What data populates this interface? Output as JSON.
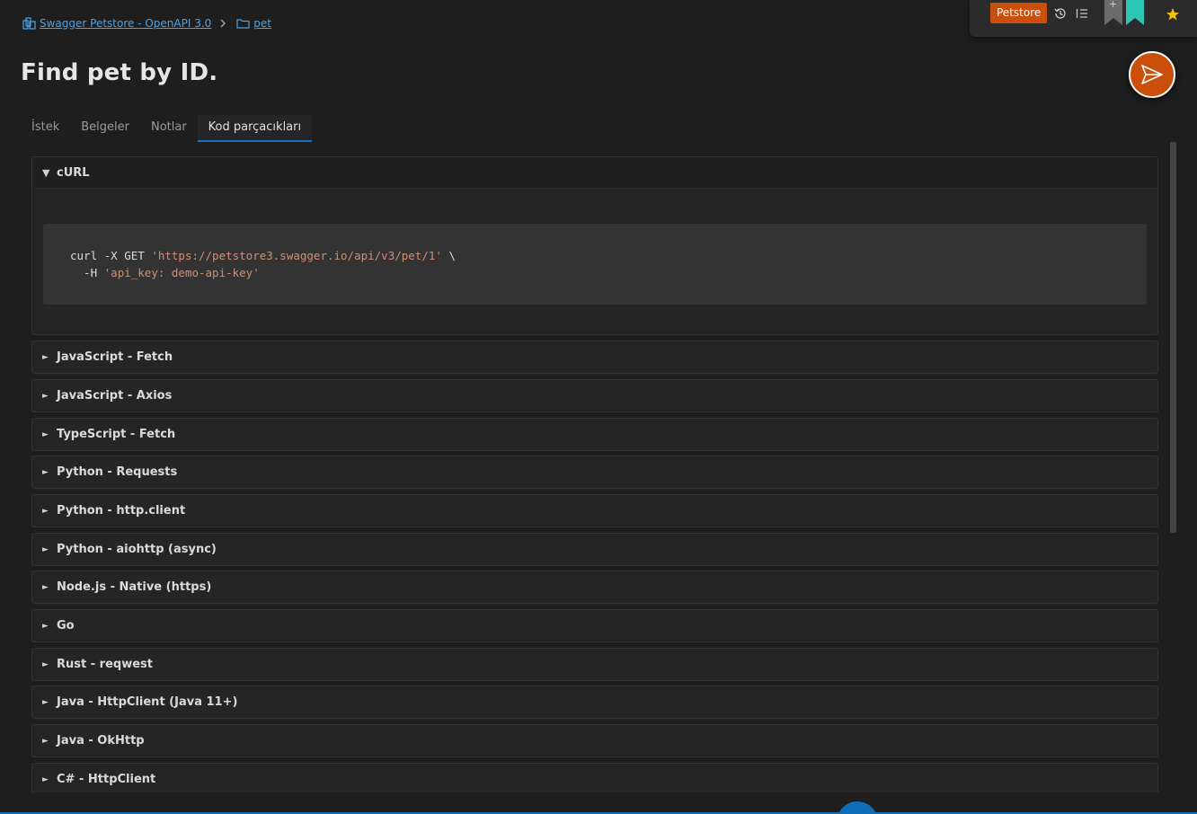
{
  "breadcrumb": {
    "collection": "Swagger Petstore - OpenAPI 3.0",
    "folder": "pet",
    "separator": ">"
  },
  "toolbar": {
    "environment": "Petstore",
    "icons": [
      "history-icon",
      "list-icon",
      "bookmark-add-icon",
      "bookmark-icon",
      "star-icon"
    ],
    "accent_color": "#c94f0a",
    "bookmark_color": "#2ec4b6",
    "star_color": "#f4c20d"
  },
  "page": {
    "title": "Find pet by ID."
  },
  "tabs": [
    {
      "label": "İstek",
      "active": false
    },
    {
      "label": "Belgeler",
      "active": false
    },
    {
      "label": "Notlar",
      "active": false
    },
    {
      "label": "Kod parçacıkları",
      "active": true
    }
  ],
  "snippets": [
    {
      "label": "cURL",
      "expanded": true,
      "code": {
        "line1_cmd": "curl -X GET ",
        "line1_str": "'https://petstore3.swagger.io/api/v3/pet/1'",
        "line1_tail": " \\",
        "line2_cmd": "  -H ",
        "line2_str": "'api_key: demo-api-key'"
      }
    },
    {
      "label": "JavaScript - Fetch",
      "expanded": false
    },
    {
      "label": "JavaScript - Axios",
      "expanded": false
    },
    {
      "label": "TypeScript - Fetch",
      "expanded": false
    },
    {
      "label": "Python - Requests",
      "expanded": false
    },
    {
      "label": "Python - http.client",
      "expanded": false
    },
    {
      "label": "Python - aiohttp (async)",
      "expanded": false
    },
    {
      "label": "Node.js - Native (https)",
      "expanded": false
    },
    {
      "label": "Go",
      "expanded": false
    },
    {
      "label": "Rust - reqwest",
      "expanded": false
    },
    {
      "label": "Java - HttpClient (Java 11+)",
      "expanded": false
    },
    {
      "label": "Java - OkHttp",
      "expanded": false
    },
    {
      "label": "C# - HttpClient",
      "expanded": false
    }
  ],
  "arrows": {
    "expanded": "▼",
    "collapsed": "►"
  }
}
